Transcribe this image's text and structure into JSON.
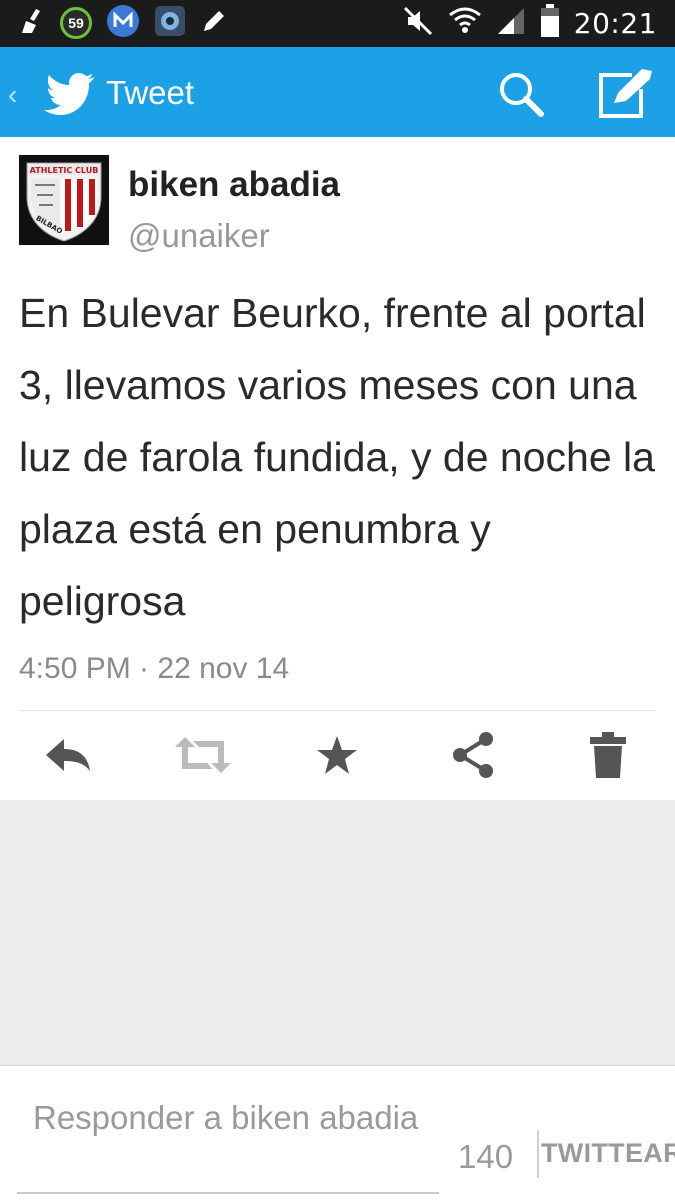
{
  "status_bar": {
    "clock": "20:21",
    "badge_value": "59",
    "icons_left": [
      "broom-icon",
      "speed-badge-icon",
      "signal-m-icon",
      "camera-app-icon",
      "pencil-icon"
    ],
    "icons_right": [
      "mute-icon",
      "wifi-icon",
      "cell-signal-icon",
      "battery-icon"
    ]
  },
  "app_bar": {
    "title": "Tweet",
    "color": "#1da1e6"
  },
  "tweet": {
    "user_name": "biken abadia",
    "handle": "@unaiker",
    "avatar_text_top": "ATHLETIC CLUB",
    "avatar_text_bottom": "BILBAO",
    "text": "En Bulevar Beurko, frente al portal 3, llevamos varios meses con una luz de farola fundida, y de noche la plaza está en penumbra y peligrosa",
    "timestamp": "4:50 PM · 22 nov 14"
  },
  "actions": [
    "reply-icon",
    "retweet-icon",
    "favorite-icon",
    "share-icon",
    "delete-icon"
  ],
  "reply_bar": {
    "placeholder": "Responder a biken abadia",
    "char_count": "140",
    "submit_label": "TWITTEAR"
  }
}
